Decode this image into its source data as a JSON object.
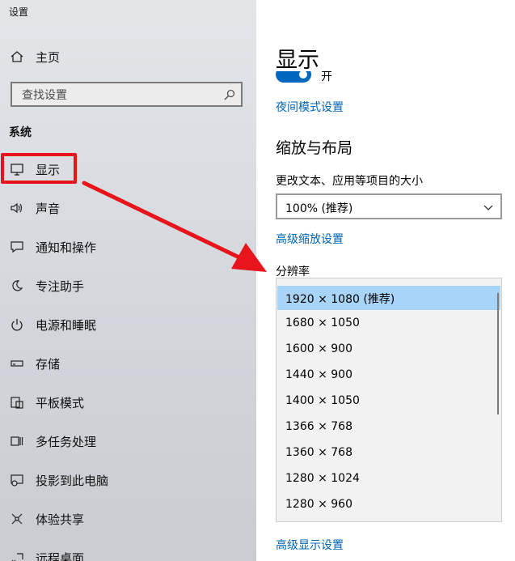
{
  "app_title": "设置",
  "sidebar": {
    "home": {
      "label": "主页",
      "icon": "home-icon"
    },
    "search": {
      "placeholder": "查找设置"
    },
    "section": "系统",
    "items": [
      {
        "label": "显示",
        "icon": "monitor-icon",
        "active": true
      },
      {
        "label": "声音",
        "icon": "speaker-icon"
      },
      {
        "label": "通知和操作",
        "icon": "notification-icon"
      },
      {
        "label": "专注助手",
        "icon": "moon-icon"
      },
      {
        "label": "电源和睡眠",
        "icon": "power-icon"
      },
      {
        "label": "存储",
        "icon": "storage-icon"
      },
      {
        "label": "平板模式",
        "icon": "tablet-icon"
      },
      {
        "label": "多任务处理",
        "icon": "multitask-icon"
      },
      {
        "label": "投影到此电脑",
        "icon": "projection-icon"
      },
      {
        "label": "体验共享",
        "icon": "share-icon"
      },
      {
        "label": "远程桌面",
        "icon": "remote-icon"
      }
    ]
  },
  "main": {
    "title": "显示",
    "toggle_text": "开",
    "night_mode_link": "夜间模式设置",
    "scale_heading": "缩放与布局",
    "scale_label": "更改文本、应用等项目的大小",
    "scale_value": "100% (推荐)",
    "advanced_scale_link": "高级缩放设置",
    "resolution_label": "分辨率",
    "resolutions": [
      "1920 × 1080 (推荐)",
      "1680 × 1050",
      "1600 × 900",
      "1440 × 900",
      "1400 × 1050",
      "1366 × 768",
      "1360 × 768",
      "1280 × 1024",
      "1280 × 960"
    ],
    "selected_resolution": "1920 × 1080 (推荐)",
    "advanced_display_link": "高级显示设置"
  },
  "colors": {
    "accent": "#0067c0",
    "link": "#0063b1",
    "highlight_red": "#e8141c",
    "selected_bg": "#a8d4f7"
  }
}
